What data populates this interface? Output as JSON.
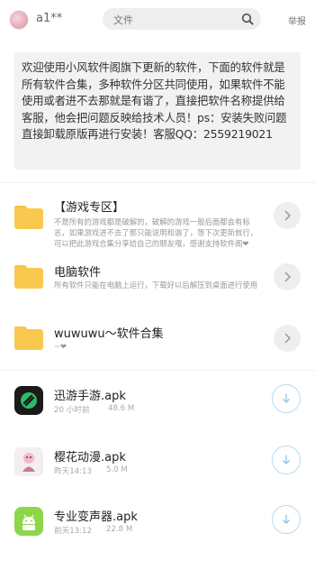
{
  "header": {
    "username": "a1**",
    "search_placeholder": "文件",
    "report_label": "举报"
  },
  "notice": {
    "text": "欢迎使用小风软件阁旗下更新的软件，下面的软件就是所有软件合集，多种软件分区共同使用，如果软件不能使用或者进不去那就是有谐了，直接把软件名称提供给客服，他会把问题反映给技术人员！ps：安装失败问题直接卸载原版再进行安装！客服QQ：2559219021"
  },
  "folders": [
    {
      "title": "【游戏专区】",
      "desc": "不是所有的游戏都是破解的，破解的游戏一般后面都会有标志，如果游戏进不去了那只能说明和谐了，等下次更新就行，可以把此游戏合集分享给自己的朋友哦，感谢支持软件阁❤"
    },
    {
      "title": "电脑软件",
      "desc": "所有软件只能在电脑上运行，下载好以后解压到桌面进行使用"
    },
    {
      "title": "wuwuwu～软件合集",
      "desc": "~❤"
    }
  ],
  "files": [
    {
      "name": "迅游手游.apk",
      "time": "20 小时前",
      "size": "48.6 M",
      "icon": "xunyou-app-icon"
    },
    {
      "name": "樱花动漫.apk",
      "time": "昨天14:13",
      "size": "5.0 M",
      "icon": "sakura-app-icon"
    },
    {
      "name": "专业变声器.apk",
      "time": "前天13:12",
      "size": "22.8 M",
      "icon": "android-app-icon"
    }
  ],
  "colors": {
    "folder": "#f9c94f",
    "download_ring": "#b9d9ee",
    "notice_bg": "#f2f2f2"
  }
}
